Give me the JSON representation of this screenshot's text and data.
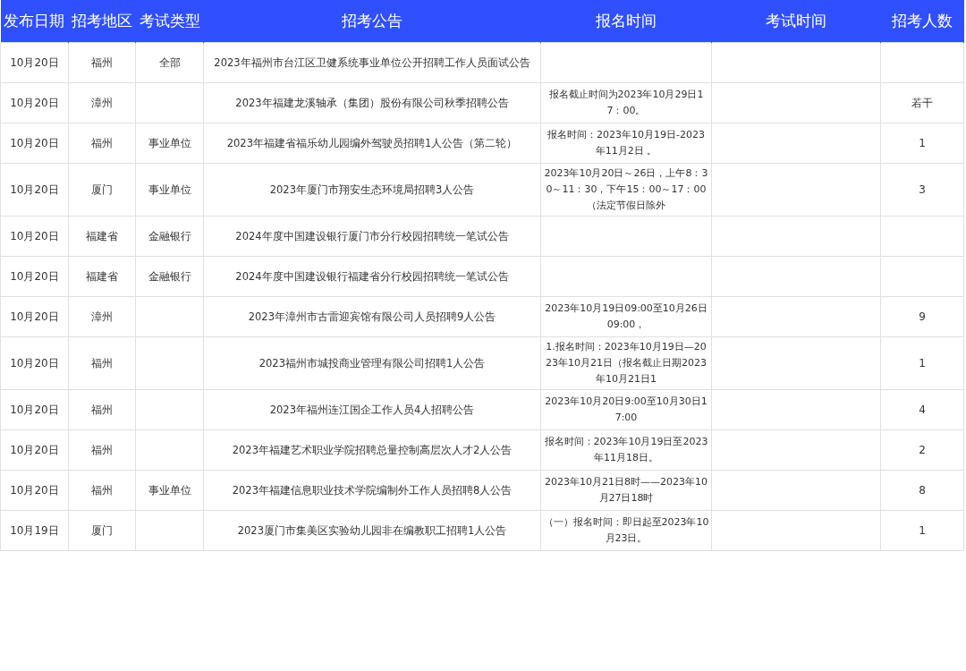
{
  "table": {
    "columns": [
      "发布日期",
      "招考地区",
      "考试类型",
      "招考公告",
      "报名时间",
      "考试时间",
      "招考人数"
    ],
    "rows": [
      {
        "date": "10月20日",
        "region": "福州",
        "type": "全部",
        "notice": "2023年福州市台江区卫健系统事业单位公开招聘工作人员面试公告",
        "signup": "",
        "exam": "",
        "count": ""
      },
      {
        "date": "10月20日",
        "region": "漳州",
        "type": "",
        "notice": "2023年福建龙溪轴承（集团）股份有限公司秋季招聘公告",
        "signup": "报名截止时间为2023年10月29日17：00。",
        "exam": "",
        "count": "若干"
      },
      {
        "date": "10月20日",
        "region": "福州",
        "type": "事业单位",
        "notice": "2023年福建省福乐幼儿园编外驾驶员招聘1人公告（第二轮）",
        "signup": "报名时间：2023年10月19日-2023年11月2日 。",
        "exam": "",
        "count": "1"
      },
      {
        "date": "10月20日",
        "region": "厦门",
        "type": "事业单位",
        "notice": "2023年厦门市翔安生态环境局招聘3人公告",
        "signup": "2023年10月20日～26日，上午8：30～11：30，下午15：00～17：00（法定节假日除外",
        "exam": "",
        "count": "3"
      },
      {
        "date": "10月20日",
        "region": "福建省",
        "type": "金融银行",
        "notice": "2024年度中国建设银行厦门市分行校园招聘统一笔试公告",
        "signup": "",
        "exam": "",
        "count": ""
      },
      {
        "date": "10月20日",
        "region": "福建省",
        "type": "金融银行",
        "notice": "2024年度中国建设银行福建省分行校园招聘统一笔试公告",
        "signup": "",
        "exam": "",
        "count": ""
      },
      {
        "date": "10月20日",
        "region": "漳州",
        "type": "",
        "notice": "2023年漳州市古雷迎宾馆有限公司人员招聘9人公告",
        "signup": "2023年10月19日09:00至10月26日09:00，",
        "exam": "",
        "count": "9"
      },
      {
        "date": "10月20日",
        "region": "福州",
        "type": "",
        "notice": "2023福州市城投商业管理有限公司招聘1人公告",
        "signup": "1.报名时间：2023年10月19日—2023年10月21日（报名截止日期2023年10月21日1",
        "exam": "",
        "count": "1"
      },
      {
        "date": "10月20日",
        "region": "福州",
        "type": "",
        "notice": "2023年福州连江国企工作人员4人招聘公告",
        "signup": "2023年10月20日9:00至10月30日17:00",
        "exam": "",
        "count": "4"
      },
      {
        "date": "10月20日",
        "region": "福州",
        "type": "",
        "notice": "2023年福建艺术职业学院招聘总量控制高层次人才2人公告",
        "signup": "报名时间：2023年10月19日至2023年11月18日。",
        "exam": "",
        "count": "2"
      },
      {
        "date": "10月20日",
        "region": "福州",
        "type": "事业单位",
        "notice": "2023年福建信息职业技术学院编制外工作人员招聘8人公告",
        "signup": "2023年10月21日8时——2023年10月27日18时",
        "exam": "",
        "count": "8"
      },
      {
        "date": "10月19日",
        "region": "厦门",
        "type": "",
        "notice": "2023厦门市集美区实验幼儿园非在编教职工招聘1人公告",
        "signup": "（一）报名时间：即日起至2023年10月23日。",
        "exam": "",
        "count": "1"
      }
    ]
  }
}
